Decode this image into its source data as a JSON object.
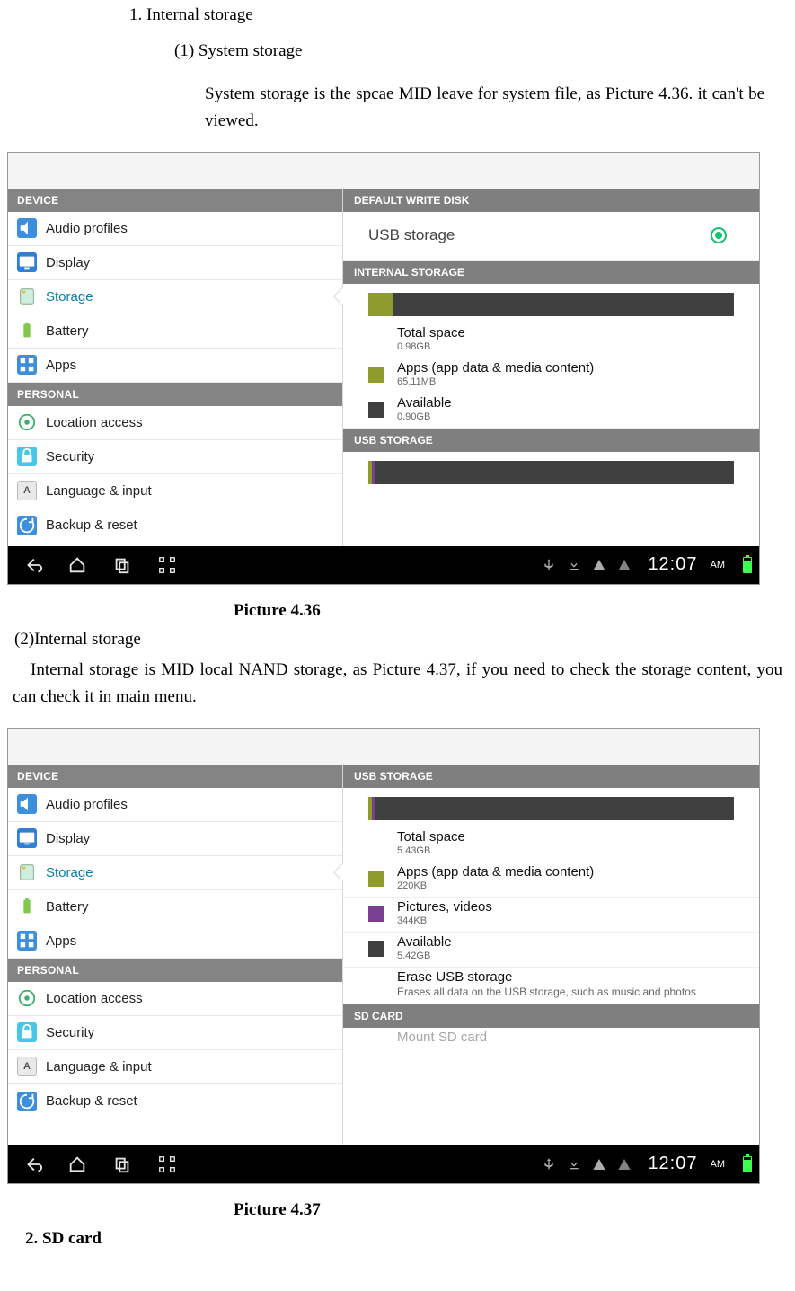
{
  "doc": {
    "list1": "1.   Internal storage",
    "sub1": "(1) System storage",
    "para1": "System storage is the spcae MID leave for system file, as Picture 4.36. it can't be viewed.",
    "caption1": "Picture 4.36",
    "h2": "(2)Internal storage",
    "para2": "Internal storage is MID local NAND storage, as Picture 4.37, if you need to check the storage content, you can check it in main menu.",
    "caption2": "Picture  4.37",
    "list2": "2.   SD card"
  },
  "sidebar": {
    "device_heading": "DEVICE",
    "personal_heading": "PERSONAL",
    "items": [
      {
        "label": "Audio profiles"
      },
      {
        "label": "Display"
      },
      {
        "label": "Storage"
      },
      {
        "label": "Battery"
      },
      {
        "label": "Apps"
      }
    ],
    "personal_items": [
      {
        "label": "Location access"
      },
      {
        "label": "Security"
      },
      {
        "label": "Language & input"
      },
      {
        "label": "Backup & reset"
      }
    ]
  },
  "s1": {
    "head_default": "DEFAULT WRITE DISK",
    "radio_label": "USB storage",
    "head_internal": "INTERNAL STORAGE",
    "total_label": "Total space",
    "total_value": "0.98GB",
    "apps_label": "Apps (app data & media content)",
    "apps_value": "65.11MB",
    "avail_label": "Available",
    "avail_value": "0.90GB",
    "head_usb": "USB STORAGE",
    "bar1_seg1_pct": "7%",
    "bar2_seg1_pct": "1%",
    "bar2_seg2_pct": "1%"
  },
  "s2": {
    "head_usb": "USB STORAGE",
    "total_label": "Total space",
    "total_value": "5.43GB",
    "apps_label": "Apps (app data & media content)",
    "apps_value": "220KB",
    "pics_label": "Pictures, videos",
    "pics_value": "344KB",
    "avail_label": "Available",
    "avail_value": "5.42GB",
    "erase_label": "Erase USB storage",
    "erase_desc": "Erases all data on the USB storage, such as music and photos",
    "head_sd": "SD CARD",
    "mount_label": "Mount SD card",
    "bar_seg1_pct": "1%",
    "bar_seg2_pct": "1%"
  },
  "navbar": {
    "time": "12:07",
    "ampm": "AM"
  }
}
